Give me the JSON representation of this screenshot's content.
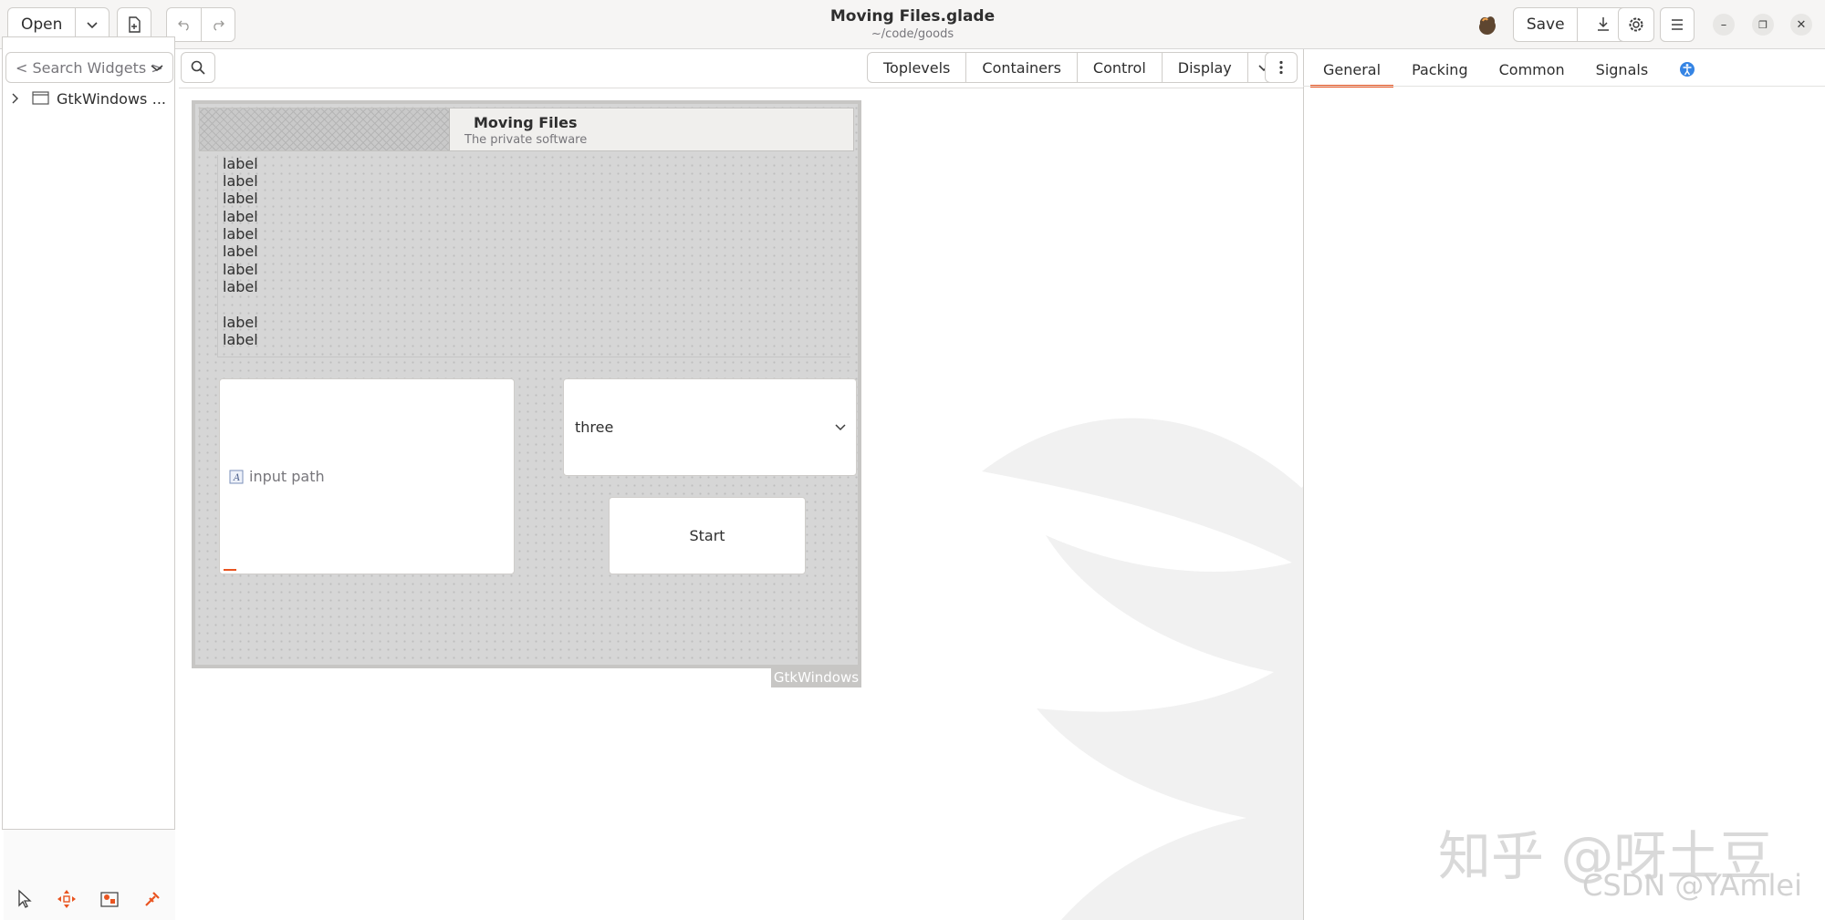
{
  "header": {
    "open_label": "Open",
    "title": "Moving Files.glade",
    "subtitle": "~/code/goods",
    "save_label": "Save"
  },
  "left": {
    "search_placeholder": "< Search Widgets >",
    "tree": [
      {
        "label": "GtkWindows",
        "more": "..."
      }
    ]
  },
  "palette": {
    "tabs": [
      "Toplevels",
      "Containers",
      "Control",
      "Display"
    ]
  },
  "inspector": {
    "tabs": [
      "General",
      "Packing",
      "Common",
      "Signals"
    ],
    "active_tab": "General"
  },
  "design": {
    "window_title": "Moving Files",
    "window_subtitle": "The private software",
    "labels": [
      "label",
      "label",
      "label",
      "label",
      "label",
      "label",
      "label",
      "label",
      "label",
      "label"
    ],
    "entry_placeholder": "input path",
    "combo_value": "three",
    "start_label": "Start",
    "window_tag": "GtkWindows"
  },
  "watermark": {
    "line1": "知乎 @呀土豆",
    "line2": "CSDN @YAmlei"
  },
  "colors": {
    "accent": "#e95420",
    "canvas_bg": "#d6d6d6"
  }
}
